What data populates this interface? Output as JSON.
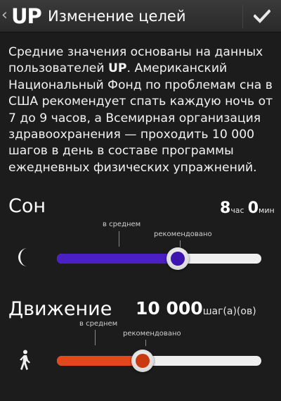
{
  "header": {
    "back_chevron": "‹",
    "logo": "UP",
    "title": "Изменение целей",
    "confirm_icon": "checkmark-icon"
  },
  "description": {
    "part1": "Средние значения основаны на данных пользователей ",
    "brand": "UP",
    "part2": ". Американский Национальный Фонд по проблемам сна в США рекомендует спать каждую ночь от 7 до 9 часов, а Всемирная организация здравоохранения — проходить 10 000 шагов в день в составе программы ежедневных физических упражнений."
  },
  "sleep": {
    "title": "Сон",
    "hours": "8",
    "hours_unit": "час",
    "minutes": "0",
    "minutes_unit": "мин",
    "average_label": "в среднем",
    "recommended_label": "рекомендовано",
    "icon": "moon-icon",
    "fill_color": "#4a1fc4",
    "knob_color": "#3d14b0",
    "level": 0.59
  },
  "movement": {
    "title": "Движение",
    "steps": "10 000",
    "steps_unit": "шаг(а)(ов)",
    "average_label": "в среднем",
    "recommended_label": "рекомендовано",
    "icon": "walking-person-icon",
    "fill_color": "#e2481c",
    "knob_color": "#c93a10",
    "level": 0.42
  }
}
